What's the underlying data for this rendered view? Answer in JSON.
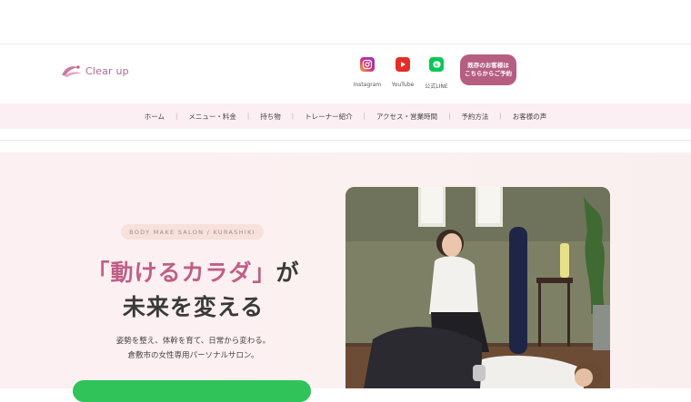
{
  "brand": {
    "logo_text": "Clear up"
  },
  "social": [
    {
      "label": "Instagram",
      "icon": "instagram-icon",
      "color": "#c13584"
    },
    {
      "label": "YouTube",
      "icon": "youtube-icon",
      "color": "#e52d27"
    },
    {
      "label": "公式LINE",
      "icon": "line-icon",
      "color": "#06c755"
    }
  ],
  "cta": {
    "line1": "既存のお客様は",
    "line2": "こちらからご予約"
  },
  "nav": {
    "items": [
      "ホーム",
      "メニュー・料金",
      "持ち物",
      "トレーナー紹介",
      "アクセス・営業時間",
      "予約方法",
      "お客様の声"
    ],
    "separator": "|"
  },
  "hero": {
    "badge": "BODY MAKE SALON / KURASHIKI",
    "headline_pink": "「動けるカラダ」",
    "headline_rest1": "が",
    "headline_line2": "未来を変える",
    "sub_line1": "姿勢を整え、体幹を育て、日常から変わる。",
    "sub_line2": "倉敷市の女性専用パーソナルサロン。"
  },
  "colors": {
    "accent": "#b65d82",
    "nav_bg": "#fbeff3",
    "hero_bg": "#fdf0f2",
    "cta_green": "#2fc35a"
  }
}
